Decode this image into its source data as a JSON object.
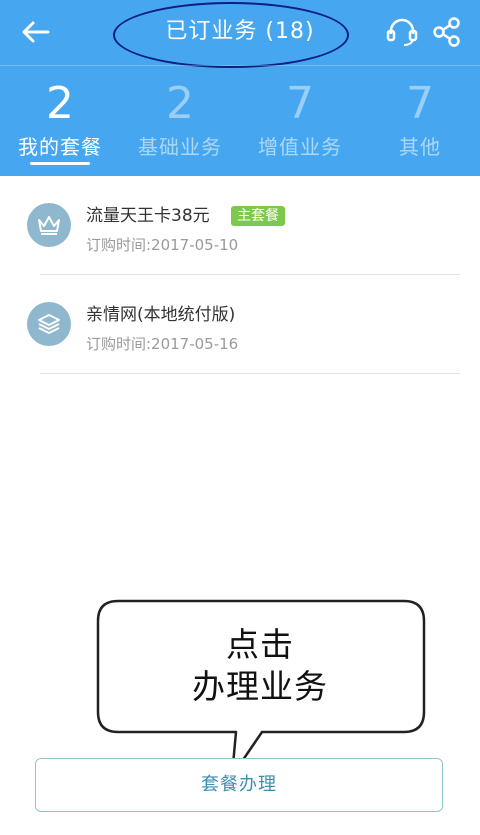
{
  "header": {
    "title": "已订业务 (18)",
    "icons": {
      "back": "arrow-left-icon",
      "service": "headset-icon",
      "share": "share-icon"
    }
  },
  "tabs": [
    {
      "count": "2",
      "label": "我的套餐",
      "active": true
    },
    {
      "count": "2",
      "label": "基础业务",
      "active": false
    },
    {
      "count": "7",
      "label": "增值业务",
      "active": false
    },
    {
      "count": "7",
      "label": "其他",
      "active": false
    }
  ],
  "packages": [
    {
      "name": "流量天王卡38元",
      "badge": "主套餐",
      "date": "订购时间:2017-05-10",
      "icon": "crown-icon"
    },
    {
      "name": "亲情网(本地统付版)",
      "badge": "",
      "date": "订购时间:2017-05-16",
      "icon": "layers-icon"
    }
  ],
  "annotation": {
    "line1": "点击",
    "line2": "办理业务"
  },
  "cta": {
    "label": "套餐办理"
  },
  "colors": {
    "header_bg": "#46a6ef",
    "badge_bg": "#7dc94d",
    "icon_bg": "#8fb8cf",
    "cta_text": "#3b8fb0",
    "oval": "#0c1f86"
  }
}
